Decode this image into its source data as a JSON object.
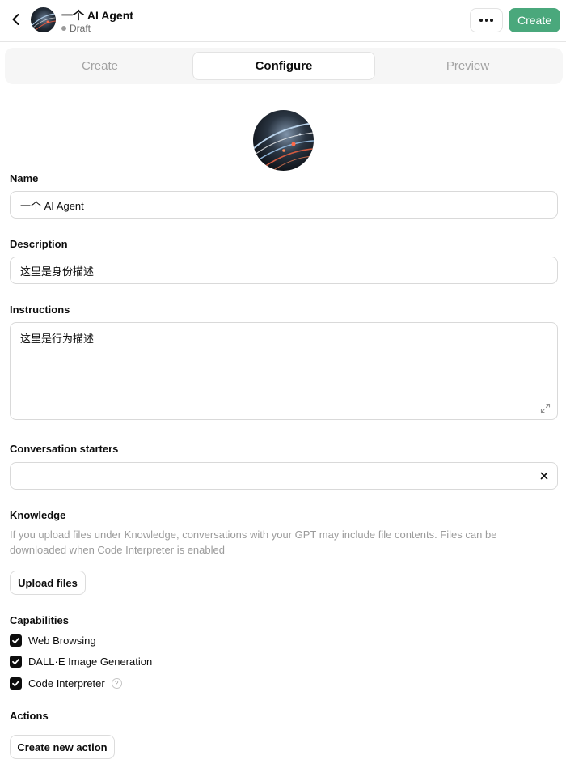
{
  "header": {
    "title": "一个 AI Agent",
    "status": "Draft",
    "create_label": "Create",
    "more_icon": "more-horizontal-icon",
    "back_icon": "chevron-left-icon"
  },
  "tabs": [
    {
      "label": "Create",
      "active": false
    },
    {
      "label": "Configure",
      "active": true
    },
    {
      "label": "Preview",
      "active": false
    }
  ],
  "form": {
    "name_label": "Name",
    "name_value": "一个 AI Agent",
    "description_label": "Description",
    "description_value": "这里是身份描述",
    "instructions_label": "Instructions",
    "instructions_value": "这里是行为描述",
    "starters_label": "Conversation starters",
    "starters_value": "",
    "knowledge_label": "Knowledge",
    "knowledge_help": "If you upload files under Knowledge, conversations with your GPT may include file contents. Files can be downloaded when Code Interpreter is enabled",
    "upload_label": "Upload files",
    "capabilities_label": "Capabilities",
    "capabilities": [
      {
        "label": "Web Browsing",
        "checked": true
      },
      {
        "label": "DALL·E Image Generation",
        "checked": true
      },
      {
        "label": "Code Interpreter",
        "checked": true
      }
    ],
    "help_glyph": "?",
    "actions_label": "Actions",
    "create_action_label": "Create new action"
  },
  "colors": {
    "accent": "#4aa87c",
    "text": "#0d0d0d",
    "muted": "#9b9b9b"
  }
}
